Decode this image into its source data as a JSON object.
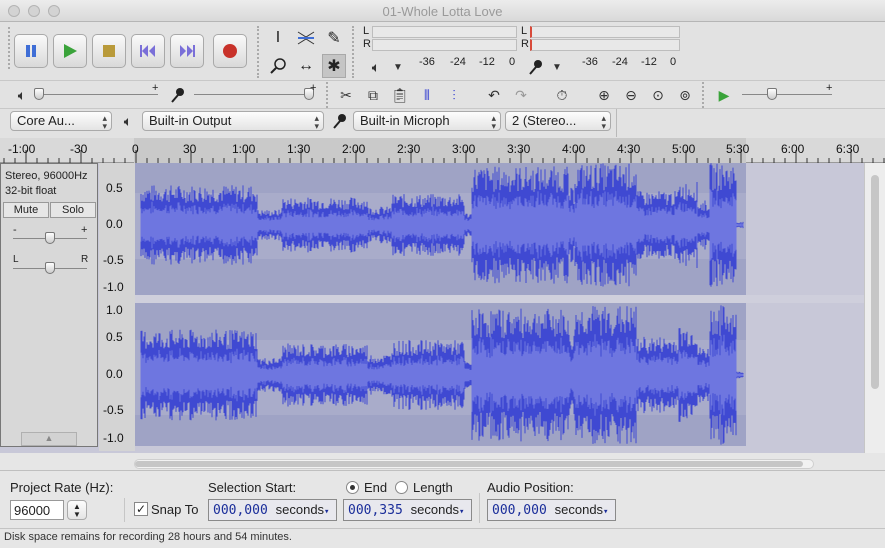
{
  "window": {
    "title": "01-Whole Lotta Love"
  },
  "transport": {
    "buttons": [
      "pause",
      "play",
      "stop",
      "skip-start",
      "skip-end",
      "record"
    ]
  },
  "meters": {
    "play_channels": [
      "L",
      "R"
    ],
    "rec_channels": [
      "L",
      "R"
    ],
    "play_scale": [
      "-36",
      "-24",
      "-12",
      "0"
    ],
    "rec_scale": [
      "-36",
      "-24",
      "-12",
      "0"
    ]
  },
  "devices": {
    "host": "Core Au...",
    "output": "Built-in Output",
    "input": "Built-in Microph",
    "channels": "2 (Stereo..."
  },
  "ruler": {
    "labels": [
      "-1:00",
      "-30",
      "0",
      "30",
      "1:00",
      "1:30",
      "2:00",
      "2:30",
      "3:00",
      "3:30",
      "4:00",
      "4:30",
      "5:00",
      "5:30",
      "6:00",
      "6:30"
    ]
  },
  "track": {
    "info_line1": "Stereo, 96000Hz",
    "info_line2": "32-bit float",
    "mute_label": "Mute",
    "solo_label": "Solo",
    "gain_minus": "-",
    "gain_plus": "+",
    "pan_left": "L",
    "pan_right": "R",
    "scale_labels": [
      "0.5",
      "0.0",
      "-0.5",
      "-1.0"
    ],
    "scale_labels_bottom": [
      "1.0",
      "0.5",
      "0.0",
      "-0.5",
      "-1.0"
    ]
  },
  "selection_bar": {
    "project_rate_label": "Project Rate (Hz):",
    "project_rate_value": "96000",
    "snap_to_label": "Snap To",
    "snap_to_checked": true,
    "selection_start_label": "Selection Start:",
    "end_label": "End",
    "length_label": "Length",
    "end_selected": true,
    "audio_position_label": "Audio Position:",
    "selection_start_value": "000,000",
    "end_value": "000,335",
    "audio_position_value": "000,000",
    "unit": "seconds"
  },
  "status": {
    "text": "Disk space remains for recording 28 hours and 54 minutes."
  },
  "colors": {
    "waveform": "#3f49d2",
    "waveform_rms": "#6e76e0",
    "wave_background": "#9fa3c5",
    "accent_play": "#3aa33a",
    "accent_pause": "#3f6ed6",
    "record": "#c8322a"
  }
}
